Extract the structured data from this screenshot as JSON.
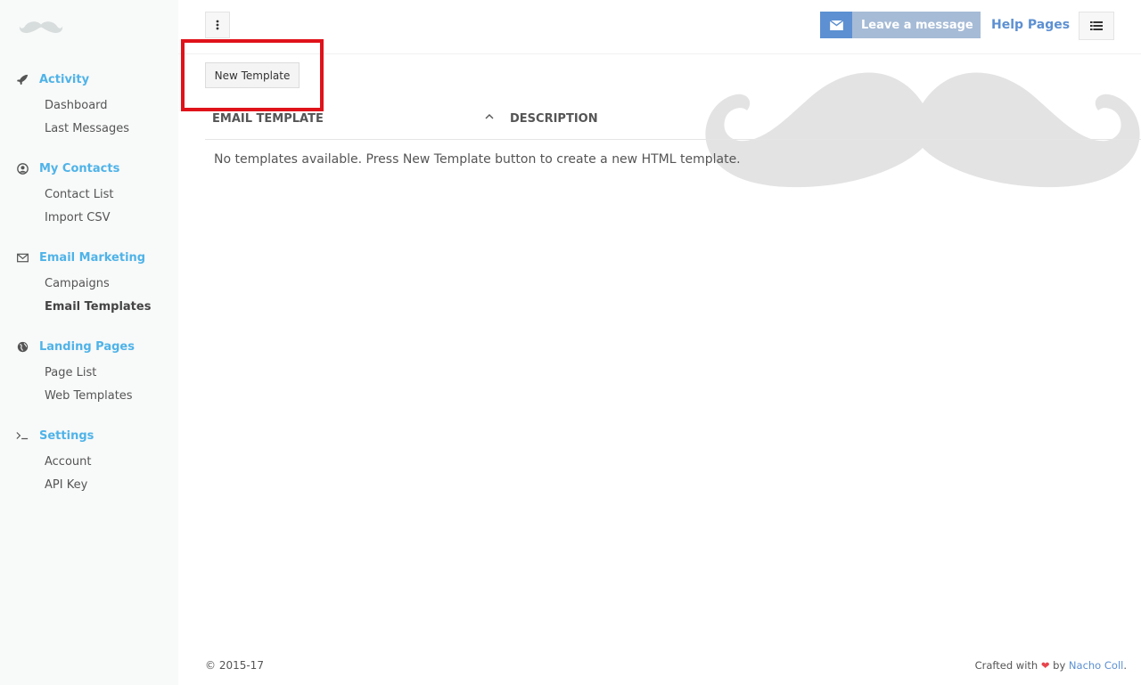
{
  "sidebar": {
    "logo_icon": "mustache-logo-icon",
    "sections": [
      {
        "icon": "rocket-icon",
        "label": "Activity",
        "items": [
          {
            "label": "Dashboard"
          },
          {
            "label": "Last Messages"
          }
        ]
      },
      {
        "icon": "user-circle-icon",
        "label": "My Contacts",
        "items": [
          {
            "label": "Contact List"
          },
          {
            "label": "Import CSV"
          }
        ]
      },
      {
        "icon": "envelope-icon",
        "label": "Email Marketing",
        "items": [
          {
            "label": "Campaigns"
          },
          {
            "label": "Email Templates",
            "active": true
          }
        ]
      },
      {
        "icon": "globe-icon",
        "label": "Landing Pages",
        "items": [
          {
            "label": "Page List"
          },
          {
            "label": "Web Templates"
          }
        ]
      },
      {
        "icon": "terminal-icon",
        "label": "Settings",
        "items": [
          {
            "label": "Account"
          },
          {
            "label": "API Key"
          }
        ]
      }
    ]
  },
  "topbar": {
    "leave_message_label": "Leave a message",
    "help_label": "Help Pages"
  },
  "content": {
    "new_template_label": "New Template",
    "table": {
      "headers": [
        "EMAIL TEMPLATE",
        "DESCRIPTION"
      ],
      "empty_text": "No templates available. Press New Template button to create a new HTML template."
    }
  },
  "footer": {
    "copyright": "© 2015-17",
    "crafted_prefix": "Crafted with",
    "heart": "❤",
    "by": "by",
    "author": "Nacho Coll",
    "suffix": "."
  },
  "colors": {
    "accent": "#4fb3e8",
    "primary": "#5c90d2",
    "highlight": "#e0121a",
    "heart": "#e8454d"
  }
}
